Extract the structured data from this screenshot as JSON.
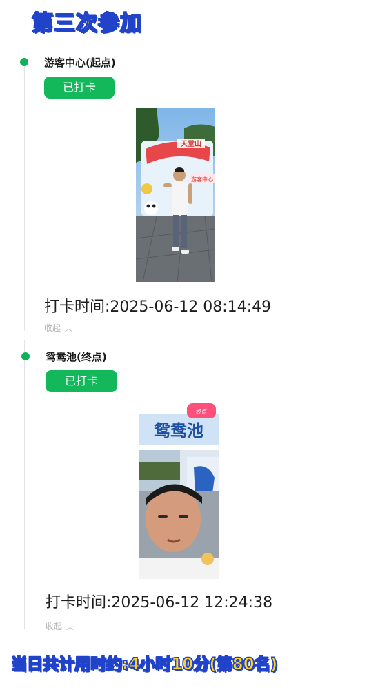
{
  "header": {
    "title": "第三次参加"
  },
  "stops": [
    {
      "name": "游客中心(起点)",
      "badge_label": "已打卡",
      "checkin_label": "打卡时间:",
      "checkin_time": "2025-06-12 08:14:49",
      "collapse_label": "收起",
      "photo_sign_text": "天堂山",
      "photo_sign_text2": "游客中心"
    },
    {
      "name": "鸳鸯池(终点)",
      "badge_label": "已打卡",
      "checkin_label": "打卡时间:",
      "checkin_time": "2025-06-12 12:24:38",
      "collapse_label": "收起",
      "photo_sign_text": "鸳鸯池",
      "photo_sign_text2": "终点"
    }
  ],
  "footer": {
    "summary": "当日共计用时约:4小时10分(第80名)"
  },
  "colors": {
    "accent_green": "#12b85a",
    "title_yellow": "#ffd21f",
    "title_outline": "#2143c9"
  }
}
